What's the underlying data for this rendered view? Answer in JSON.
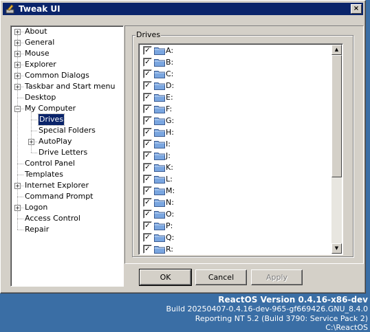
{
  "window": {
    "title": "Tweak UI",
    "close_symbol": "×"
  },
  "tree": {
    "items": [
      {
        "label": "About",
        "expand": "+",
        "level": 0
      },
      {
        "label": "General",
        "expand": "+",
        "level": 0
      },
      {
        "label": "Mouse",
        "expand": "+",
        "level": 0
      },
      {
        "label": "Explorer",
        "expand": "+",
        "level": 0
      },
      {
        "label": "Common Dialogs",
        "expand": "+",
        "level": 0
      },
      {
        "label": "Taskbar and Start menu",
        "expand": "+",
        "level": 0
      },
      {
        "label": "Desktop",
        "expand": "",
        "level": 0
      },
      {
        "label": "My Computer",
        "expand": "−",
        "level": 0
      },
      {
        "label": "Drives",
        "expand": "",
        "level": 1,
        "selected": true
      },
      {
        "label": "Special Folders",
        "expand": "",
        "level": 1
      },
      {
        "label": "AutoPlay",
        "expand": "+",
        "level": 1
      },
      {
        "label": "Drive Letters",
        "expand": "",
        "level": 1
      },
      {
        "label": "Control Panel",
        "expand": "",
        "level": 0
      },
      {
        "label": "Templates",
        "expand": "",
        "level": 0
      },
      {
        "label": "Internet Explorer",
        "expand": "+",
        "level": 0
      },
      {
        "label": "Command Prompt",
        "expand": "",
        "level": 0
      },
      {
        "label": "Logon",
        "expand": "+",
        "level": 0
      },
      {
        "label": "Access Control",
        "expand": "",
        "level": 0
      },
      {
        "label": "Repair",
        "expand": "",
        "level": 0
      }
    ]
  },
  "drives": {
    "group_title": "Drives",
    "check_mark": "✓",
    "items": [
      {
        "label": "A:",
        "checked": true
      },
      {
        "label": "B:",
        "checked": true
      },
      {
        "label": "C:",
        "checked": true
      },
      {
        "label": "D:",
        "checked": true
      },
      {
        "label": "E:",
        "checked": true
      },
      {
        "label": "F:",
        "checked": true
      },
      {
        "label": "G:",
        "checked": true
      },
      {
        "label": "H:",
        "checked": true
      },
      {
        "label": "I:",
        "checked": true
      },
      {
        "label": "J:",
        "checked": true
      },
      {
        "label": "K:",
        "checked": true
      },
      {
        "label": "L:",
        "checked": true
      },
      {
        "label": "M:",
        "checked": true
      },
      {
        "label": "N:",
        "checked": true
      },
      {
        "label": "O:",
        "checked": true
      },
      {
        "label": "P:",
        "checked": true
      },
      {
        "label": "Q:",
        "checked": true
      },
      {
        "label": "R:",
        "checked": true
      }
    ],
    "scroll_up": "▲",
    "scroll_down": "▼"
  },
  "buttons": {
    "ok": "OK",
    "cancel": "Cancel",
    "apply": "Apply"
  },
  "desktop": {
    "version": "ReactOS Version 0.4.16-x86-dev",
    "build": "Build 20250407-0.4.16-dev-965-gf669426.GNU_8.4.0",
    "reporting": "Reporting NT 5.2 (Build 3790: Service Pack 2)",
    "path": "C:\\ReactOS"
  },
  "colors": {
    "titlebar": "#0a246a",
    "desktop": "#3a6ea5",
    "face": "#d4d0c8",
    "folder": "#7aa6e0"
  }
}
